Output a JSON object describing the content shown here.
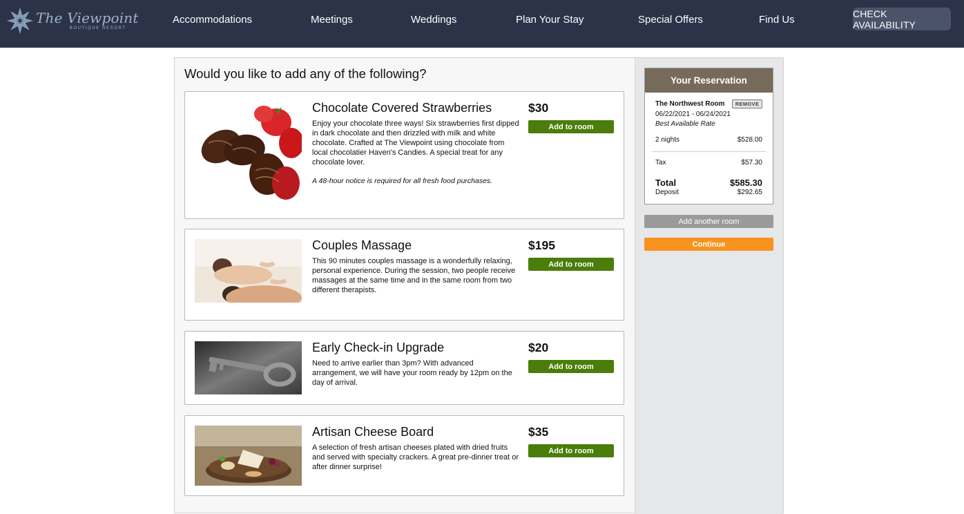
{
  "header": {
    "logo_name": "The Viewpoint",
    "logo_sub": "BOUTIQUE RESORT",
    "nav": [
      "Accommodations",
      "Meetings",
      "Weddings",
      "Plan Your Stay",
      "Special Offers",
      "Find Us"
    ],
    "cta": "CHECK AVAILABILITY"
  },
  "main": {
    "question": "Would you like to add any of the following?",
    "add_label": "Add to room",
    "items": [
      {
        "title": "Chocolate Covered Strawberries",
        "price": "$30",
        "description": "Enjoy your chocolate three ways! Six strawberries first dipped in dark chocolate and then drizzled with milk and white chocolate. Crafted at The Viewpoint using chocolate from local chocolatier Haven's Candies. A special treat for any chocolate lover.",
        "note": "A 48-hour notice is required for all fresh food purchases."
      },
      {
        "title": "Couples Massage",
        "price": "$195",
        "description": "This 90 minutes couples massage is a wonderfully relaxing, personal experience. During the session, two people receive massages at the same time and in the same room from two different therapists."
      },
      {
        "title": "Early Check-in Upgrade",
        "price": "$20",
        "description": "Need to arrive earlier than 3pm? With advanced arrangement, we will have your room ready by 12pm on the day of arrival."
      },
      {
        "title": "Artisan Cheese Board",
        "price": "$35",
        "description": "A selection of fresh artisan cheeses plated with dried fruits and served with specialty crackers. A great pre-dinner treat or after dinner surprise!"
      }
    ]
  },
  "reservation": {
    "heading": "Your Reservation",
    "room": "The Northwest Room",
    "remove": "REMOVE",
    "dates": "06/22/2021 - 06/24/2021",
    "rate": "Best Available Rate",
    "nights_label": "2 nights",
    "nights_amount": "$528.00",
    "tax_label": "Tax",
    "tax_amount": "$57.30",
    "total_label": "Total",
    "total_amount": "$585.30",
    "deposit_label": "Deposit",
    "deposit_amount": "$292.65"
  },
  "actions": {
    "add_another": "Add another room",
    "continue": "Continue"
  },
  "colors": {
    "topbar": "#2c3349",
    "add_button": "#4a7d0a",
    "continue_button": "#f7931e",
    "reservation_header": "#766a5b"
  }
}
